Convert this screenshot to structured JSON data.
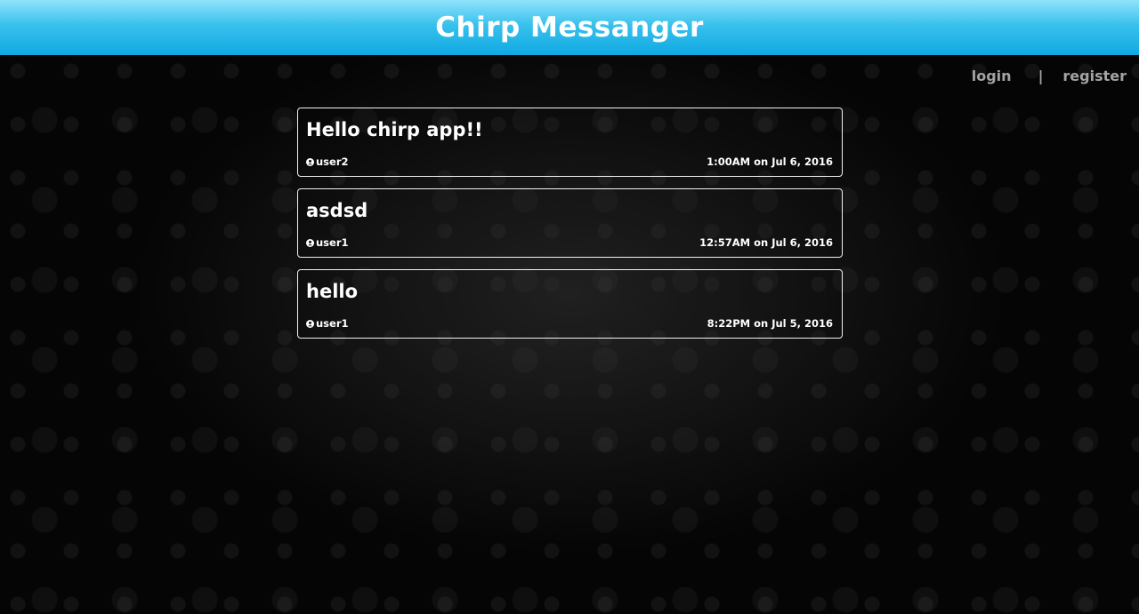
{
  "header": {
    "title": "Chirp Messanger"
  },
  "auth_nav": {
    "login_label": "login",
    "separator": "|",
    "register_label": "register"
  },
  "posts": [
    {
      "text": "Hello chirp app!!",
      "author_icon": "user-icon",
      "author": "user2",
      "timestamp": "1:00AM on Jul 6, 2016"
    },
    {
      "text": "asdsd",
      "author_icon": "user-icon",
      "author": "user1",
      "timestamp": "12:57AM on Jul 6, 2016"
    },
    {
      "text": "hello",
      "author_icon": "user-icon",
      "author": "user1",
      "timestamp": "8:22PM on Jul 5, 2016"
    }
  ],
  "colors": {
    "header_top": "#8fe3fb",
    "header_bottom": "#10a9e2",
    "background": "#050505",
    "nav_text": "#a3a3a3",
    "post_border": "#f2f2f2"
  }
}
